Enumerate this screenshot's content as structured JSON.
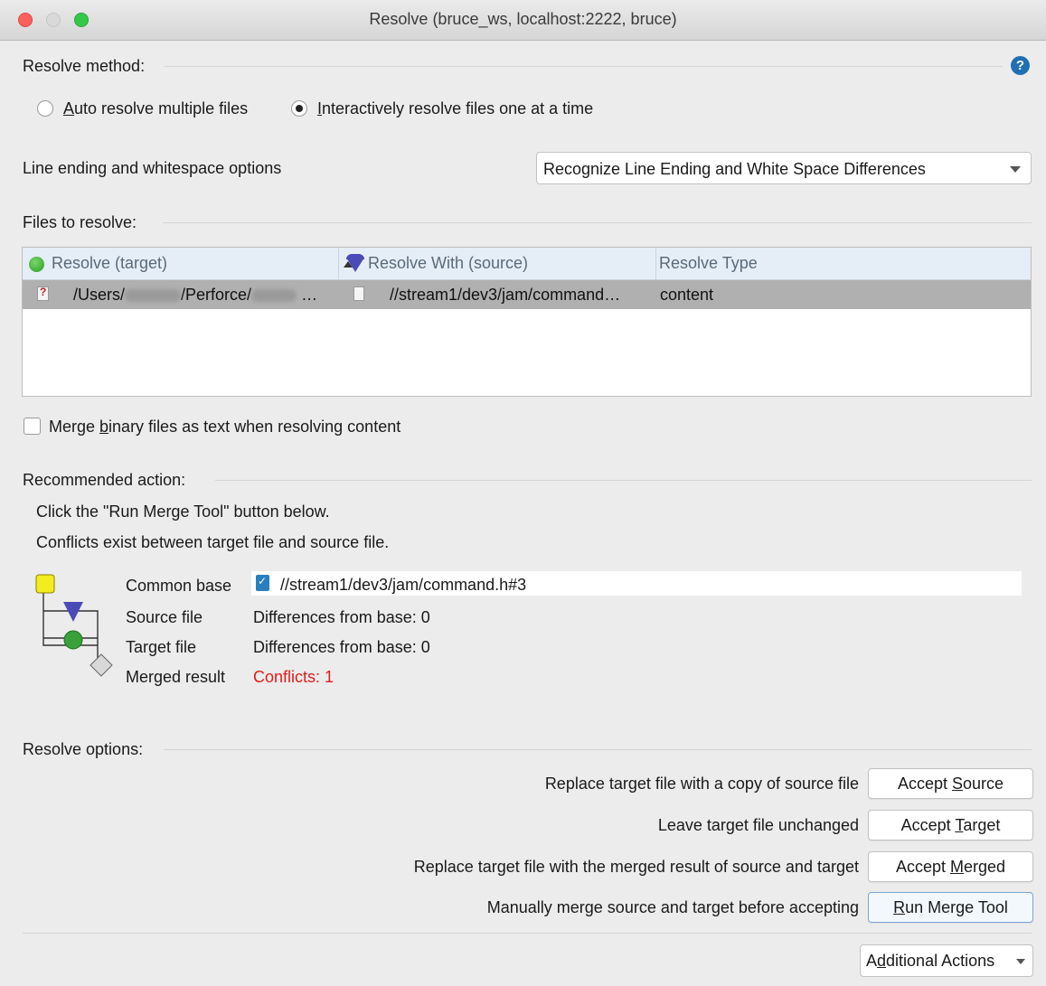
{
  "window": {
    "title": "Resolve (bruce_ws,  localhost:2222,  bruce)"
  },
  "resolve_method": {
    "label": "Resolve method:",
    "help_icon": "question-circle-icon",
    "options": [
      {
        "prefix": "",
        "mnemonic": "A",
        "rest": "uto resolve multiple files",
        "selected": false
      },
      {
        "prefix": "",
        "mnemonic": "I",
        "rest": "nteractively resolve files one at a time",
        "selected": true
      }
    ]
  },
  "line_ending": {
    "label": "Line ending and whitespace options",
    "selected": "Recognize Line Ending and White Space Differences"
  },
  "files": {
    "label": "Files to resolve:",
    "columns": [
      "Resolve (target)",
      "Resolve With (source)",
      "Resolve Type"
    ],
    "row": {
      "target_a": "/Users/",
      "target_b": "/Perforce/",
      "target_c": "…",
      "source": "//stream1/dev3/jam/command…",
      "type": "content"
    }
  },
  "merge_binary": {
    "prefix": "Merge ",
    "mnemonic": "b",
    "rest": "inary files as text when resolving content",
    "checked": false
  },
  "recommended": {
    "label": "Recommended action:",
    "line1": "Click the \"Run Merge Tool\" button below.",
    "line2": "Conflicts exist between target file and source file.",
    "common_base_label": "Common base",
    "common_base_value": "//stream1/dev3/jam/command.h#3",
    "source_label": "Source file",
    "source_value": "Differences from base: 0",
    "target_label": "Target file",
    "target_value": "Differences from base: 0",
    "merged_label": "Merged result",
    "merged_value": "Conflicts: 1",
    "conflict_color": "#e31b1b"
  },
  "resolve_options": {
    "label": "Resolve options:",
    "actions": [
      {
        "desc": "Replace target file with a copy of source file",
        "pre": "Accept ",
        "mn": "S",
        "post": "ource"
      },
      {
        "desc": "Leave target file unchanged",
        "pre": "Accept ",
        "mn": "T",
        "post": "arget"
      },
      {
        "desc": "Replace target file with the merged result of source and target",
        "pre": "Accept ",
        "mn": "M",
        "post": "erged"
      },
      {
        "desc": "Manually merge source and target before accepting",
        "pre": "",
        "mn": "R",
        "post": "un Merge Tool"
      }
    ]
  },
  "footer": {
    "pre": "A",
    "mn": "d",
    "post": "ditional Actions"
  }
}
